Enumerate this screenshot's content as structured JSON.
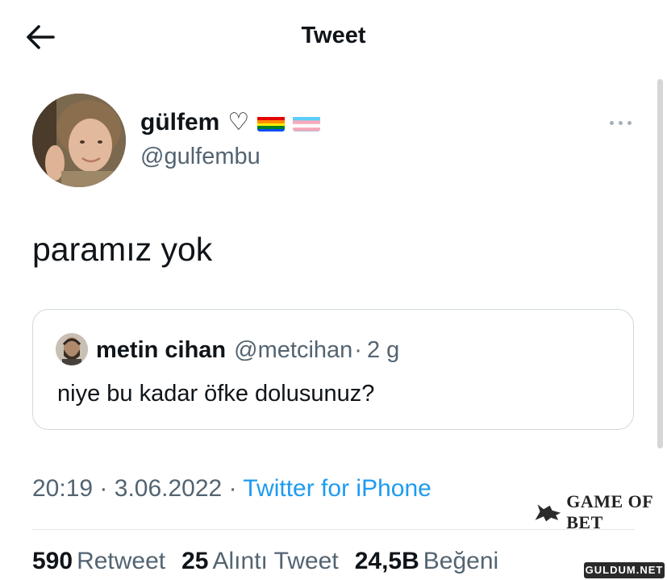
{
  "header": {
    "title": "Tweet",
    "back_icon": "arrow-left-icon"
  },
  "author": {
    "display_name": "gülfem",
    "name_heart": "♡",
    "badges": [
      "rainbow-flag",
      "transgender-flag"
    ],
    "handle": "@gulfembu"
  },
  "tweet": {
    "text": "paramız yok"
  },
  "quote": {
    "name": "metin cihan",
    "handle": "@metcihan",
    "separator": "·",
    "time": "2 g",
    "text": "niye bu kadar öfke dolusunuz?"
  },
  "meta": {
    "time": "20:19",
    "separator": "·",
    "date": "3.06.2022",
    "source": "Twitter for iPhone"
  },
  "stats": {
    "retweets_count": "590",
    "retweets_label": "Retweet",
    "quotes_count": "25",
    "quotes_label": "Alıntı Tweet",
    "likes_count": "24,5B",
    "likes_label": "Beğeni"
  },
  "watermarks": {
    "game_of_bet": "GAME OF BET",
    "guldum": "GULDUM.NET"
  },
  "colors": {
    "text": "#0f1419",
    "secondary": "#536471",
    "link": "#1d9bf0",
    "border": "#cfd9de"
  }
}
